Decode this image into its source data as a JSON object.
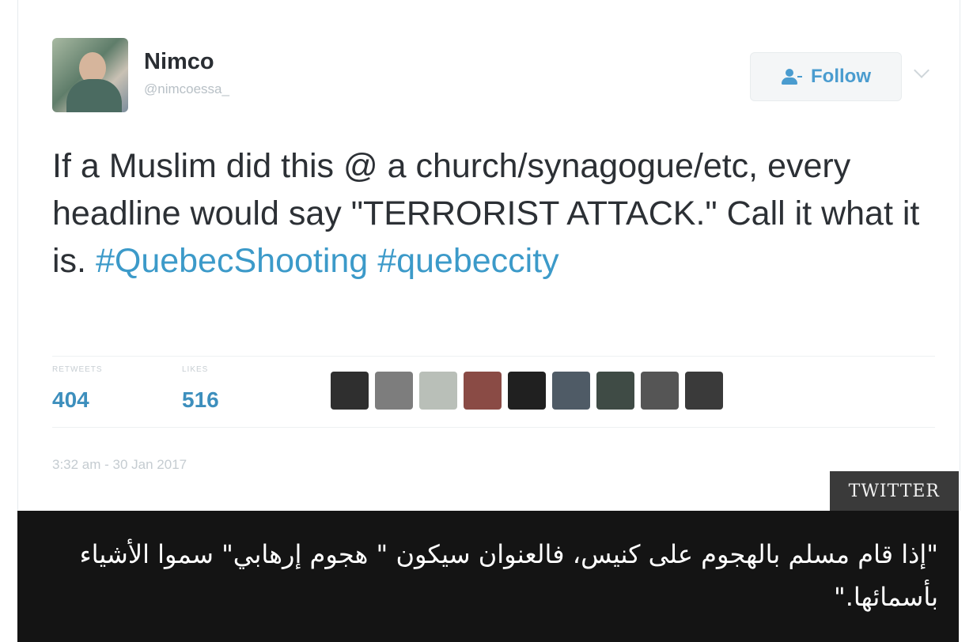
{
  "tweet": {
    "author_name": "Nimco",
    "author_handle": "@nimcoessa_",
    "follow_label": "Follow",
    "text_plain_1": "If a Muslim did this @ a church/synagogue/etc, every headline would say \"TERRORIST ATTACK.\" Call it what it is. ",
    "hashtag_1": "#QuebecShooting",
    "hashtag_2": "#quebeccity",
    "retweets_label": "RETWEETS",
    "retweets_count": "404",
    "likes_label": "LIKES",
    "likes_count": "516",
    "timestamp": "3:32 am - 30 Jan 2017",
    "liker_avatar_colors": [
      "#2f2f2f",
      "#7d7d7d",
      "#b9bfb8",
      "#8a4b45",
      "#202020",
      "#4f5b66",
      "#3f4b45",
      "#555555",
      "#3a3a3a"
    ]
  },
  "source_label": "TWITTER",
  "caption": "\"إذا قام مسلم بالهجوم على كنيس، فالعنوان سيكون \" هجوم إرهابي\" سموا الأشياء بأسمائها.\"",
  "colors": {
    "hashtag": "#3c9ac9",
    "stat_value": "#3d8fbd",
    "caption_bg": "#141414",
    "badge_bg": "#3a3a3a"
  }
}
